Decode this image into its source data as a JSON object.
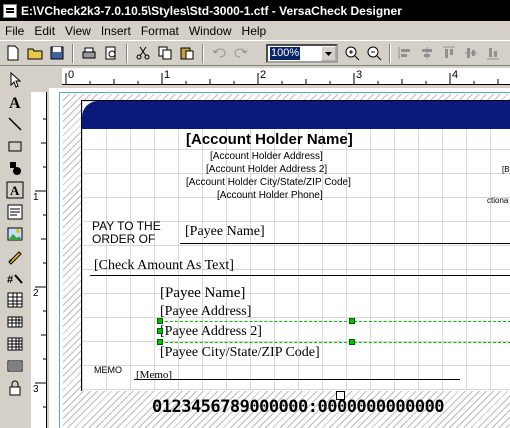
{
  "window": {
    "title": "E:\\VCheck2k3-7.0.10.5\\Styles\\Std-3000-1.ctf - VersaCheck Designer"
  },
  "menu": [
    {
      "label": "File"
    },
    {
      "label": "Edit"
    },
    {
      "label": "View"
    },
    {
      "label": "Insert"
    },
    {
      "label": "Format"
    },
    {
      "label": "Window"
    },
    {
      "label": "Help"
    }
  ],
  "toolbar": {
    "zoom_value": "100%"
  },
  "ruler": {
    "h_marks": [
      "0",
      "1",
      "2",
      "3",
      "4"
    ],
    "v_marks": [
      "1",
      "2",
      "3"
    ]
  },
  "check": {
    "account_holder_name": "[Account Holder Name]",
    "address": "[Account Holder Address]",
    "address2": "[Account Holder Address 2]",
    "city_state_zip": "[Account Holder City/State/ZIP Code]",
    "phone": "[Account Holder Phone]",
    "right_fragment_1": "[B",
    "right_fragment_2": "ctiona",
    "pay_to_line1": "PAY TO THE",
    "pay_to_line2": "ORDER OF",
    "payee_name_line": "[Payee Name]",
    "amount_text": "[Check Amount As Text]",
    "payee_block_name": "[Payee Name]",
    "payee_block_address": "[Payee Address]",
    "payee_block_address2": "[Payee Address 2]",
    "payee_block_city": "[Payee City/State/ZIP Code]",
    "memo_label": "MEMO",
    "memo_value": "[Memo]",
    "micr_line": "0123456789000000:0000000000000"
  }
}
